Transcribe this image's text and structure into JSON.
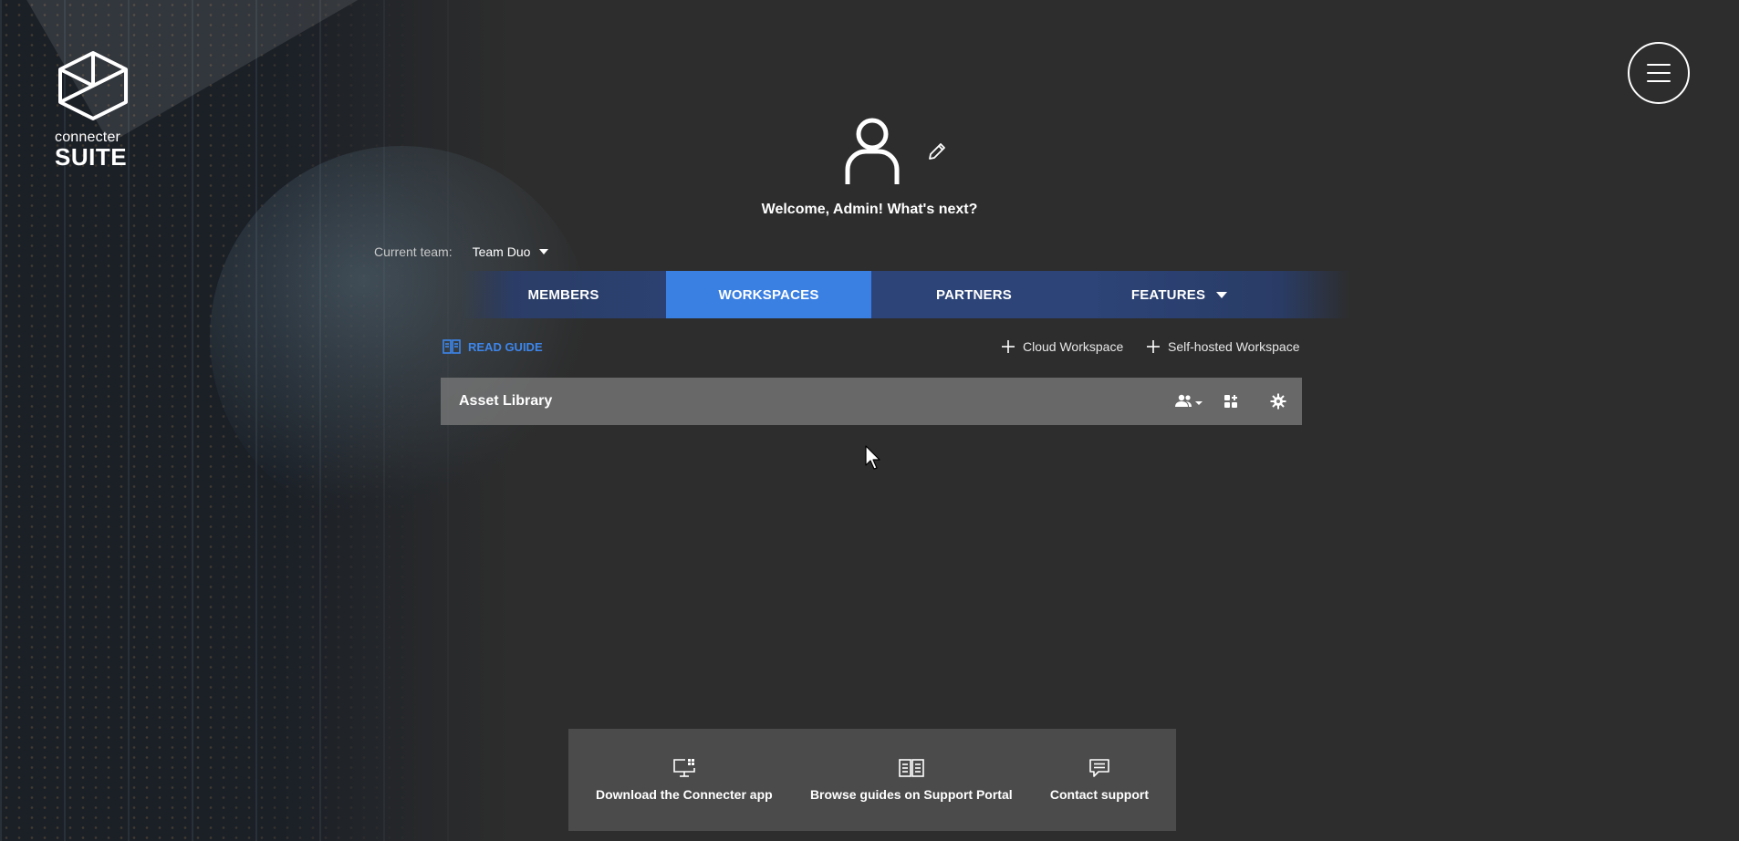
{
  "brand": {
    "top": "connecter",
    "bottom": "SUITE"
  },
  "profile": {
    "welcome": "Welcome, Admin! What's next?"
  },
  "team": {
    "label": "Current team:",
    "value": "Team Duo"
  },
  "tabs": [
    {
      "label": "MEMBERS"
    },
    {
      "label": "WORKSPACES"
    },
    {
      "label": "PARTNERS"
    },
    {
      "label": "FEATURES"
    }
  ],
  "actions": {
    "read_guide": "READ GUIDE",
    "cloud_workspace": "Cloud Workspace",
    "self_hosted_workspace": "Self-hosted Workspace"
  },
  "workspaces": [
    {
      "name": "Asset Library"
    }
  ],
  "footer": [
    {
      "label": "Download the Connecter app",
      "icon": "monitor-icon"
    },
    {
      "label": "Browse guides on Support Portal",
      "icon": "book-icon"
    },
    {
      "label": "Contact support",
      "icon": "chat-icon"
    }
  ],
  "colors": {
    "accent": "#3a7fe2",
    "link": "#3d86ec",
    "background": "#2d2d2d",
    "tab_bar": "#2c4478"
  }
}
